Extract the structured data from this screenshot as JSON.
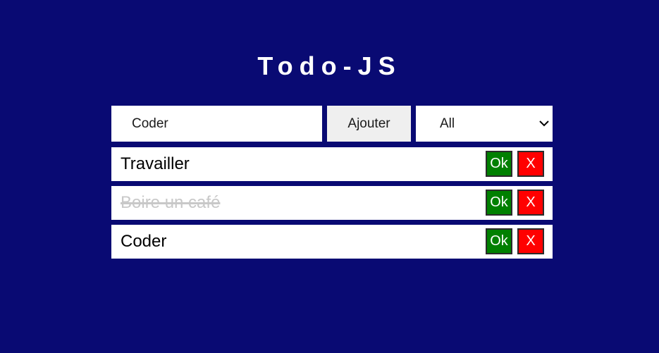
{
  "app": {
    "title": "Todo-JS"
  },
  "form": {
    "input_value": "Coder",
    "add_label": "Ajouter",
    "filter_selected": "All",
    "filter_icon": "chevron-down-icon"
  },
  "todos": [
    {
      "text": "Travailler",
      "completed": false,
      "ok_label": "Ok",
      "delete_label": "X"
    },
    {
      "text": "Boire un café",
      "completed": true,
      "ok_label": "Ok",
      "delete_label": "X"
    },
    {
      "text": "Coder",
      "completed": false,
      "ok_label": "Ok",
      "delete_label": "X"
    }
  ],
  "colors": {
    "background": "#090a73",
    "ok": "#008000",
    "delete": "#ff0000",
    "completed_text": "#c8c8c8"
  }
}
